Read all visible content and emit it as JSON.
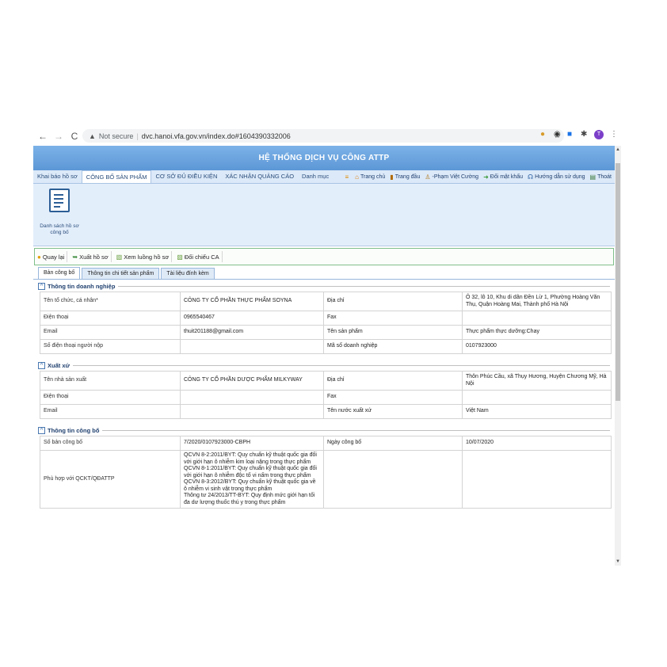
{
  "browser": {
    "not_secure": "Not secure",
    "url": "dvc.hanoi.vfa.gov.vn/index.do#1604390332006",
    "profile_initial": "T"
  },
  "app": {
    "title": "HỆ THỐNG DỊCH VỤ CÔNG ATTP",
    "menu": [
      "Khai báo hồ sơ",
      "CÔNG BỐ SẢN PHẨM",
      "CƠ SỞ ĐỦ ĐIỀU KIỆN",
      "XÁC NHẬN QUẢNG CÁO",
      "Danh mục"
    ],
    "quick_links": [
      "Trang chủ",
      "Trang đầu",
      "-Phạm Việt Cường",
      "Đổi mật khẩu",
      "Hướng dẫn sử dụng",
      "Thoát"
    ],
    "ribbon_button": "Danh sách hồ sơ công bố",
    "toolbar": [
      "Quay lại",
      "Xuất hồ sơ",
      "Xem luồng hồ sơ",
      "Đối chiếu CA"
    ],
    "tabs": [
      "Bản công bố",
      "Thông tin chi tiết sản phẩm",
      "Tài liệu đính kèm"
    ]
  },
  "business": {
    "title": "Thông tin doanh nghiệp",
    "rows": [
      [
        "Tên tổ chức, cá nhân*",
        "CÔNG TY CỔ PHẦN THỰC PHẨM SOYNA",
        "Địa chỉ",
        "Ô 32, lô 10, Khu di dân Đền Lừ 1, Phường Hoàng Văn Thụ, Quận Hoàng Mai, Thành phố Hà Nội"
      ],
      [
        "Điện thoại",
        "0965540467",
        "Fax",
        ""
      ],
      [
        "Email",
        "thuit201188@gmail.com",
        "Tên sản phẩm",
        "Thực phẩm thực dưỡng:Chay"
      ],
      [
        "Số điện thoại người nộp",
        "",
        "Mã số doanh nghiệp",
        "0107923000"
      ]
    ]
  },
  "origin": {
    "title": "Xuất xứ",
    "rows": [
      [
        "Tên nhà sản xuất",
        "CÔNG TY CỔ PHẦN DƯỢC PHẨM MILKYWAY",
        "Địa chỉ",
        "Thôn Phúc Cầu, xã Thụy Hương, Huyện Chương Mỹ, Hà Nội"
      ],
      [
        "Điện thoại",
        "",
        "Fax",
        ""
      ],
      [
        "Email",
        "",
        "Tên nước xuất xứ",
        "Việt Nam"
      ]
    ]
  },
  "announcement": {
    "title": "Thông tin công bố",
    "rows": [
      [
        "Số bản công bố",
        "7/2020/0107923000-CBPH",
        "Ngày công bố",
        "10/07/2020"
      ],
      [
        "Phù hợp với QCKT/QĐATTP",
        "QCVN 8-2:2011/BYT: Quy chuẩn kỹ thuật quốc gia đối với giới hạn ô nhiễm kim loại nặng trong thực phẩm\nQCVN 8-1:2011/BYT: Quy chuẩn kỹ thuật quốc gia đối với giới hạn ô nhiễm độc tố vi nấm trong thực phẩm\nQCVN 8-3:2012/BYT: Quy chuẩn kỹ thuật quốc gia về ô nhiễm vi sinh vật trong thực phẩm\nThông tư 24/2013/TT-BYT: Quy định mức giới hạn tối đa dư lượng thuốc thú y trong thực phẩm",
        "",
        ""
      ]
    ]
  }
}
